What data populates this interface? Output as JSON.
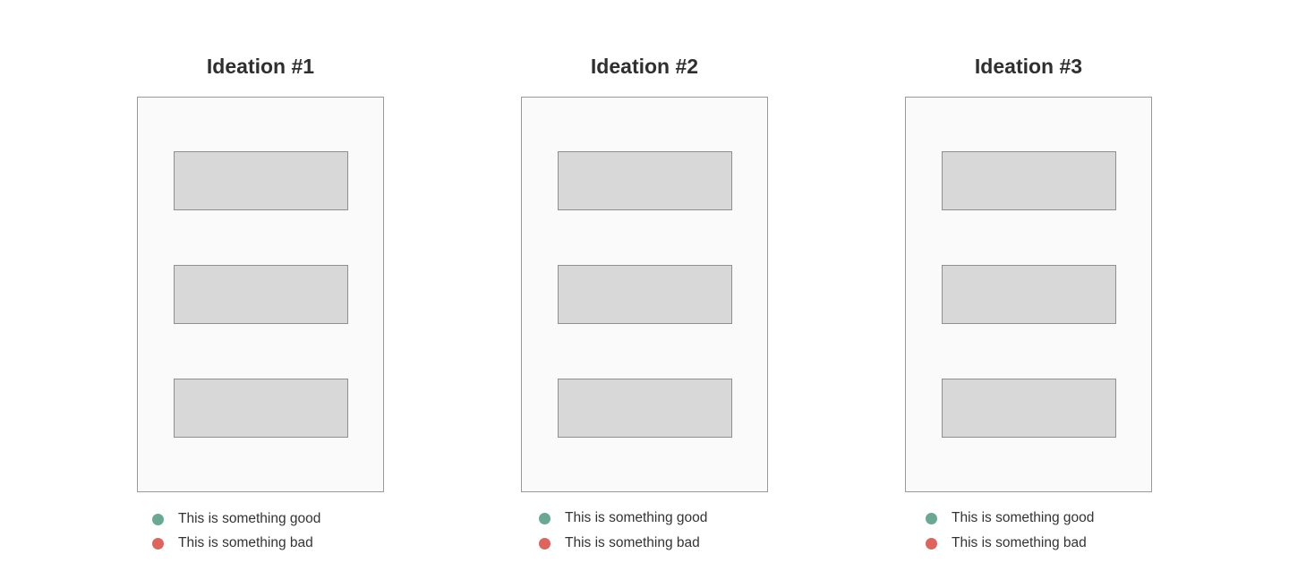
{
  "colors": {
    "good": "#6aa895",
    "bad": "#dd6561"
  },
  "ideations": [
    {
      "title": "Ideation #1",
      "legend": {
        "good_label": "This is something good",
        "bad_label": "This is something bad"
      }
    },
    {
      "title": "Ideation #2",
      "legend": {
        "good_label": "This is something good",
        "bad_label": "This is something bad"
      }
    },
    {
      "title": "Ideation #3",
      "legend": {
        "good_label": "This is something good",
        "bad_label": "This is something bad"
      }
    }
  ]
}
